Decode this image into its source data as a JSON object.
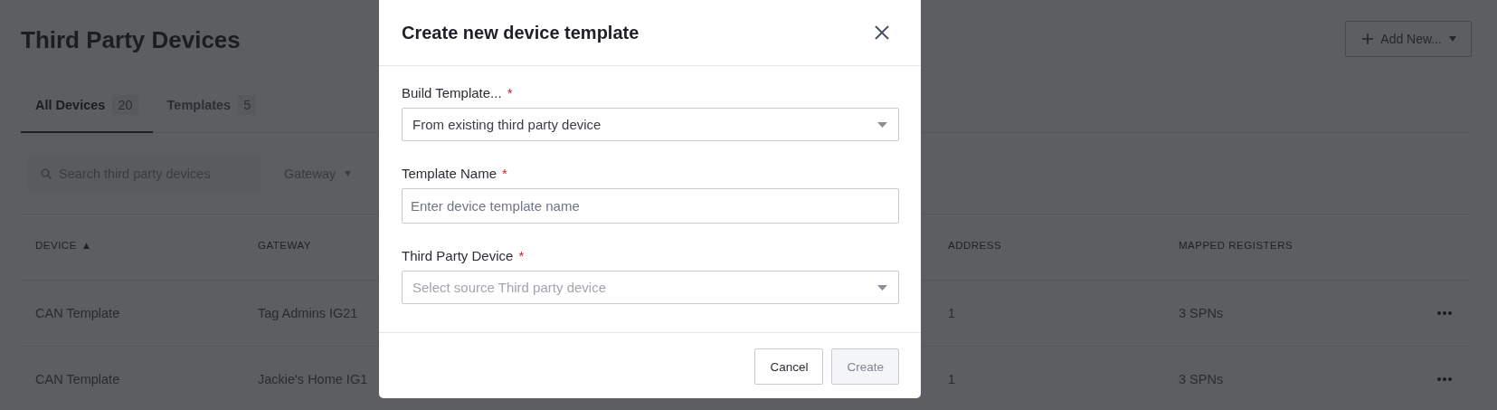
{
  "page": {
    "title": "Third Party Devices",
    "add_button": {
      "label": "Add New..."
    }
  },
  "tabs": [
    {
      "label": "All Devices",
      "count": "20",
      "selected": true
    },
    {
      "label": "Templates",
      "count": "5",
      "selected": false
    }
  ],
  "filters": {
    "search": {
      "placeholder": "Search third party devices"
    },
    "gateway_filter": {
      "label": "Gateway"
    }
  },
  "table": {
    "columns": [
      {
        "label": "DEVICE",
        "sort": "▲"
      },
      {
        "label": "GATEWAY"
      },
      {
        "label": "ADDRESS"
      },
      {
        "label": "MAPPED REGISTERS"
      }
    ],
    "rows": [
      {
        "cells": [
          "CAN Template",
          "Tag Admins IG21",
          "1",
          "3 SPNs"
        ]
      },
      {
        "cells": [
          "CAN Template",
          "Jackie's Home IG1",
          "1",
          "3 SPNs"
        ]
      }
    ]
  },
  "dialog": {
    "title": "Create new device template",
    "fields": [
      {
        "kind": "select",
        "label": "Build Template...",
        "required_mark": "*",
        "value": "From existing third party device"
      },
      {
        "kind": "text",
        "label": "Template Name",
        "required_mark": "*",
        "placeholder": "Enter device template name"
      },
      {
        "kind": "select",
        "label": "Third Party Device",
        "required_mark": "*",
        "placeholder": "Select source Third party device"
      }
    ],
    "buttons": [
      {
        "label": "Cancel",
        "disabled": false
      },
      {
        "label": "Create",
        "disabled": true
      }
    ]
  }
}
